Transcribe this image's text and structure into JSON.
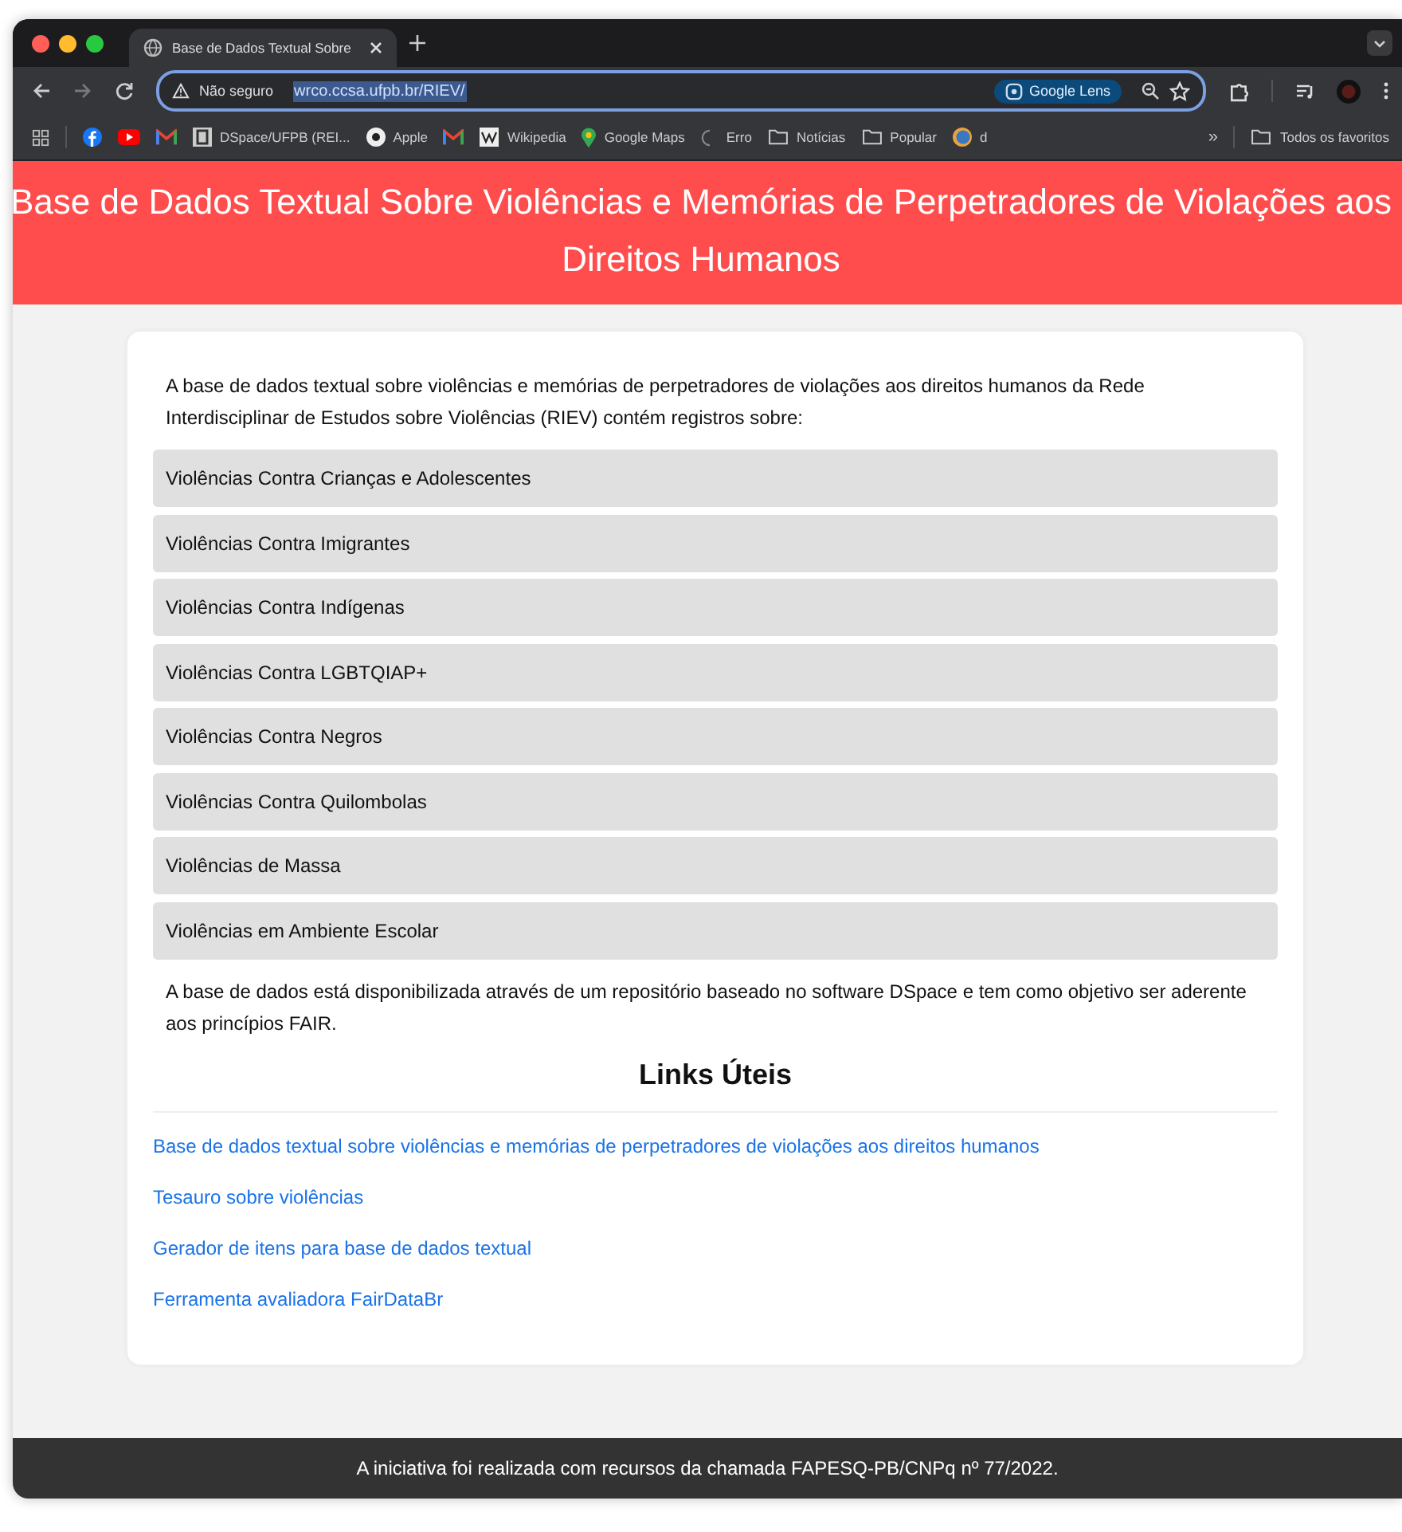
{
  "browser": {
    "tab_title": "Base de Dados Textual Sobre",
    "url_warning": "Não seguro",
    "url": "wrco.ccsa.ufpb.br/RIEV/",
    "lens_label": "Google Lens",
    "bookmarks": [
      {
        "kind": "facebook"
      },
      {
        "kind": "video"
      },
      {
        "kind": "mail"
      },
      {
        "kind": "doc",
        "label": "DSpace/UFPB (REI..."
      },
      {
        "kind": "ring",
        "label": "Apple"
      },
      {
        "kind": "mail"
      },
      {
        "kind": "wiki",
        "label": "Wikipedia"
      },
      {
        "kind": "pin",
        "label": "Google Maps"
      },
      {
        "kind": "loading",
        "label": "Erro"
      },
      {
        "kind": "folder",
        "label": "Notícias"
      },
      {
        "kind": "folder",
        "label": "Popular"
      },
      {
        "kind": "globe",
        "label": "d"
      }
    ],
    "more_label": "»",
    "all_bookmarks": "Todos os favoritos"
  },
  "header": {
    "title": "Base de Dados Textual Sobre Violências e Memórias de Perpetradores de Violações aos Direitos Humanos"
  },
  "intro": "A base de dados textual sobre violências e memórias de perpetradores de violações aos direitos humanos da Rede Interdisciplinar de Estudos sobre Violências (RIEV) contém registros sobre:",
  "categories": [
    "Violências Contra Crianças e Adolescentes",
    "Violências Contra Imigrantes",
    "Violências Contra Indígenas",
    "Violências Contra LGBTQIAP+",
    "Violências Contra Negros",
    "Violências Contra Quilombolas",
    "Violências de Massa",
    "Violências em Ambiente Escolar"
  ],
  "description": "A base de dados está disponibilizada através de um repositório baseado no software DSpace e tem como objetivo ser aderente aos princípios FAIR.",
  "links_heading": "Links Úteis",
  "links": [
    "Base de dados textual sobre violências e memórias de perpetradores de violações aos direitos humanos",
    "Tesauro sobre violências",
    "Gerador de itens para base de dados textual",
    "Ferramenta avaliadora FairDataBr"
  ],
  "footer": "A iniciativa foi realizada com recursos da chamada FAPESQ-PB/CNPq nº 77/2022."
}
